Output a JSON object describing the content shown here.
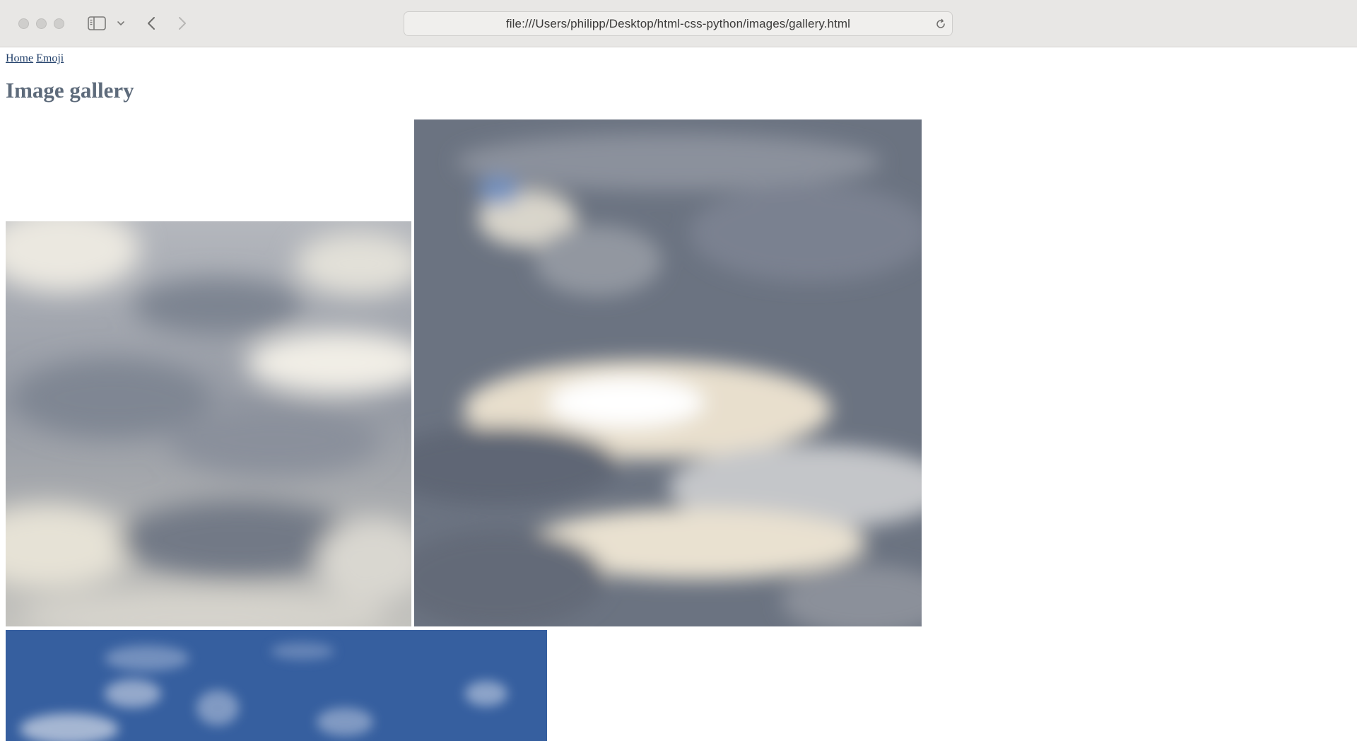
{
  "browser": {
    "address": "file:///Users/philipp/Desktop/html-css-python/images/gallery.html",
    "icons": {
      "sidebar": "sidebar-icon",
      "chevron": "chevron-down-icon",
      "back": "back-arrow-icon",
      "forward": "forward-arrow-icon",
      "reload": "reload-icon"
    }
  },
  "page": {
    "nav": {
      "home_label": "Home",
      "emoji_label": "Emoji"
    },
    "title": "Image gallery",
    "images": [
      {
        "name": "cloudy-sky-1",
        "tones": [
          "#9ea3ad",
          "#e9e6dd",
          "#7c8391"
        ]
      },
      {
        "name": "cloudy-sky-2",
        "tones": [
          "#6c7482",
          "#ede4d3",
          "#b0b3b7"
        ]
      },
      {
        "name": "blue-sky",
        "tones": [
          "#365f9f",
          "#b9c6dc"
        ]
      }
    ]
  },
  "colors": {
    "toolbar": "#e8e7e5",
    "title": "#5e6b7b",
    "link": "#23416b"
  }
}
